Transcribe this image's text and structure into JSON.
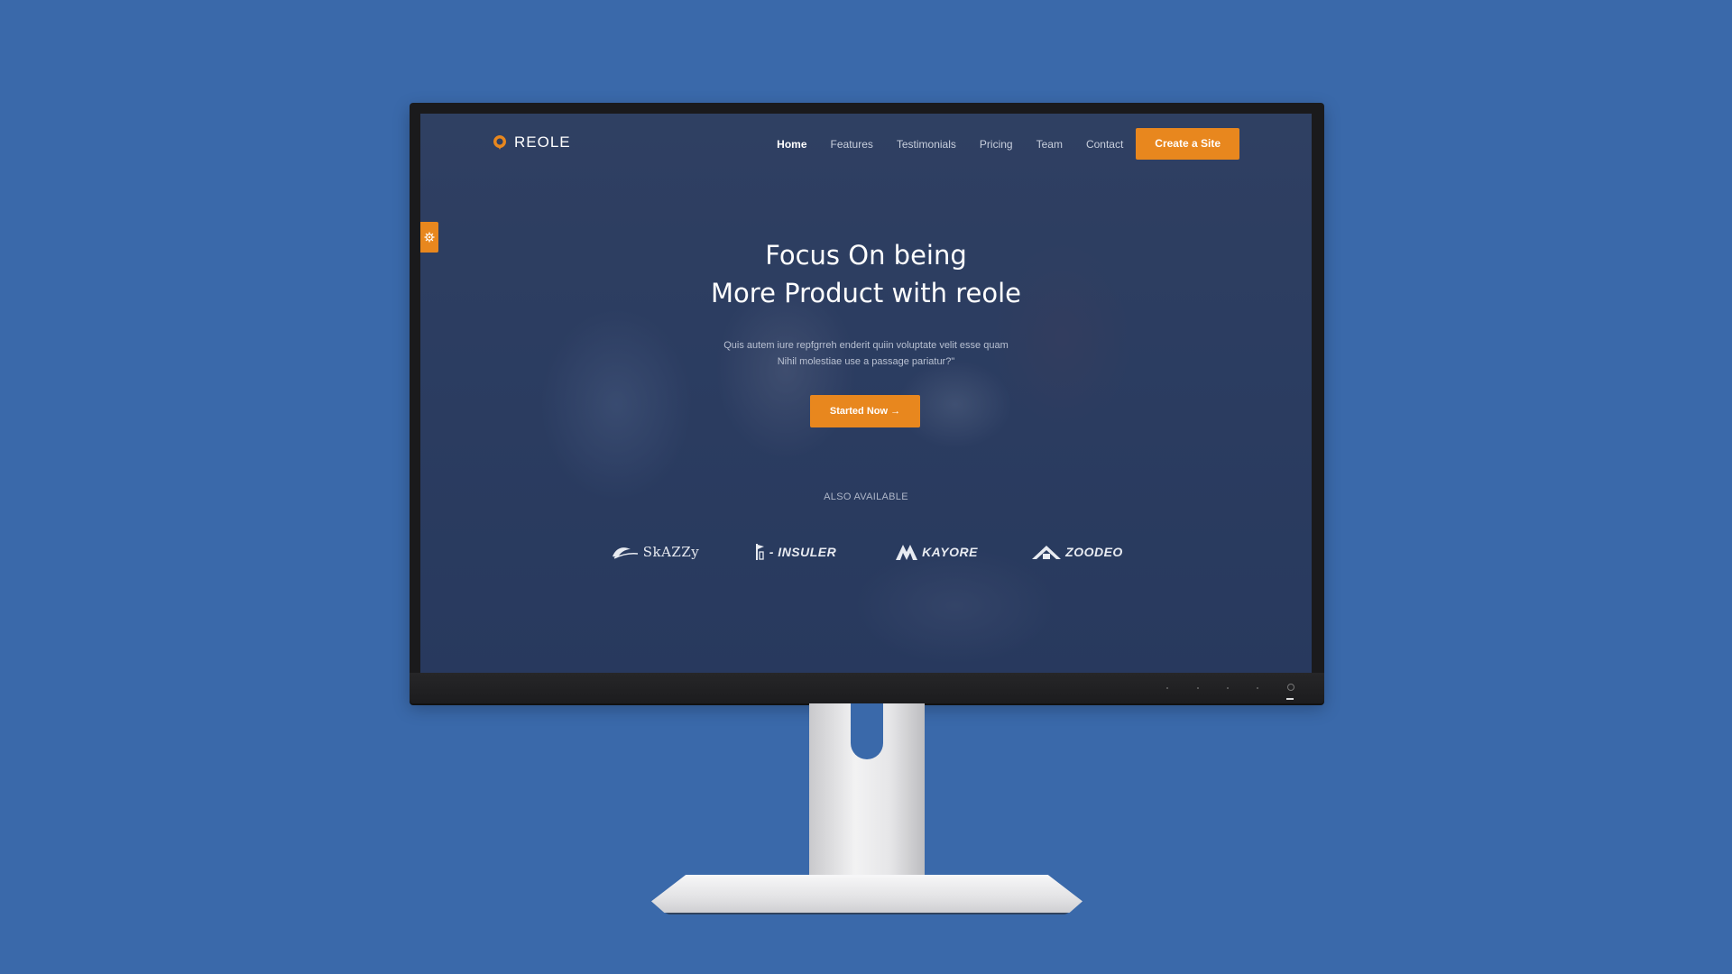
{
  "site": {
    "logo_text": "REOLE",
    "nav": {
      "items": [
        {
          "label": "Home",
          "active": true
        },
        {
          "label": "Features",
          "active": false
        },
        {
          "label": "Testimonials",
          "active": false
        },
        {
          "label": "Pricing",
          "active": false
        },
        {
          "label": "Team",
          "active": false
        },
        {
          "label": "Contact",
          "active": false
        }
      ],
      "cta_label": "Create a Site"
    },
    "hero": {
      "title_line1": "Focus On being",
      "title_line2": "More Product with reole",
      "subtitle_line1": "Quis autem iure repfgrreh enderit quiin voluptate velit esse quam",
      "subtitle_line2": "Nihil molestiae use a passage pariatur?\"",
      "button_label": "Started Now →"
    },
    "also_available": "ALSO AVAILABLE",
    "brands": [
      {
        "name": "SkAZZy",
        "icon": "wave-logo-icon"
      },
      {
        "name": "- INSULER",
        "icon": "flag-logo-icon"
      },
      {
        "name": "KAYORE",
        "icon": "mountain-logo-icon"
      },
      {
        "name": "ZOODEO",
        "icon": "roof-logo-icon"
      }
    ]
  },
  "colors": {
    "background": "#3a69aa",
    "accent": "#e8871e",
    "nav_text": "#c8cfdd"
  }
}
